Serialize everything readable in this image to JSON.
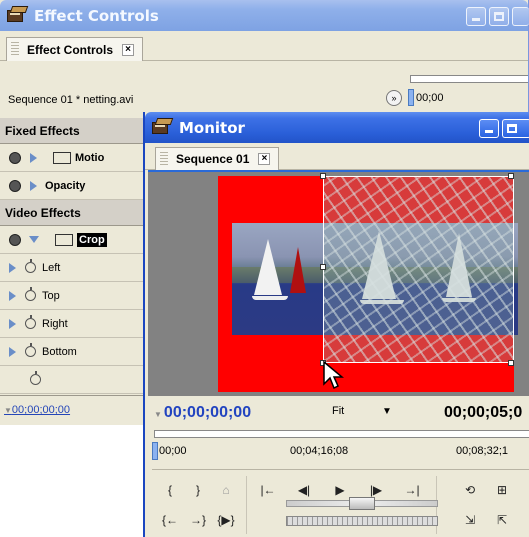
{
  "effect_controls": {
    "title": "Effect Controls",
    "tab_label": "Effect Controls",
    "tab_close": "×",
    "sequence_clip": "Sequence 01 * netting.avi",
    "timeline_start": "00;00",
    "forward_button": "»",
    "sections": {
      "fixed": "Fixed Effects",
      "video": "Video Effects"
    },
    "fixed_effects": [
      {
        "label": "Motio"
      },
      {
        "label": "Opacity"
      }
    ],
    "video_effect": {
      "label": "Crop"
    },
    "crop_params": [
      "Left",
      "Top",
      "Right",
      "Bottom",
      ""
    ],
    "timecode": "00;00;00;00"
  },
  "monitor": {
    "title": "Monitor",
    "tab_label": "Sequence 01",
    "tab_close": "×",
    "current_timecode": "00;00;00;00",
    "zoom": "Fit",
    "zoom_arrow": "▼",
    "duration_timecode": "00;00;05;0",
    "ruler_labels": [
      "00;00",
      "00;04;16;08",
      "00;08;32;1"
    ],
    "buttons_row1": [
      "{",
      "}",
      "⌂",
      "|←",
      "◀|",
      "▶",
      "|▶",
      "→|",
      "⟲",
      "⊞"
    ],
    "buttons_row2": [
      "{←",
      "→}",
      "{▶}",
      "",
      "",
      "",
      "",
      "",
      "⇲",
      "⇱"
    ]
  },
  "colors": {
    "title_active": "#2a5fd8",
    "title_inactive": "#8fb0ea",
    "panel_bg": "#ece9d8",
    "timecode_blue": "#2244c0",
    "video_red": "#ff0000"
  }
}
